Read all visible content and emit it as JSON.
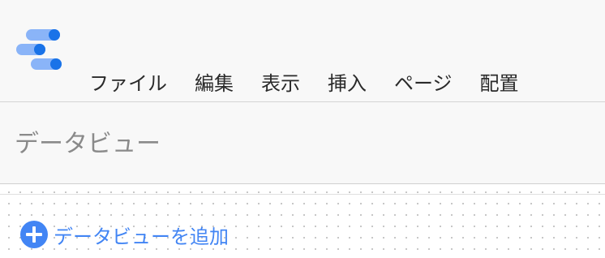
{
  "header": {
    "logo_icon": "data-studio-logo-icon",
    "menu": [
      {
        "label": "ファイル"
      },
      {
        "label": "編集"
      },
      {
        "label": "表示"
      },
      {
        "label": "挿入"
      },
      {
        "label": "ページ"
      },
      {
        "label": "配置"
      }
    ]
  },
  "panel": {
    "title": "データビュー",
    "add_button": {
      "icon": "add-circle-icon",
      "label": "データビューを追加"
    }
  },
  "colors": {
    "accent": "#4285f4",
    "logo_dark": "#1a73e8",
    "logo_light": "#8ab4f8"
  }
}
